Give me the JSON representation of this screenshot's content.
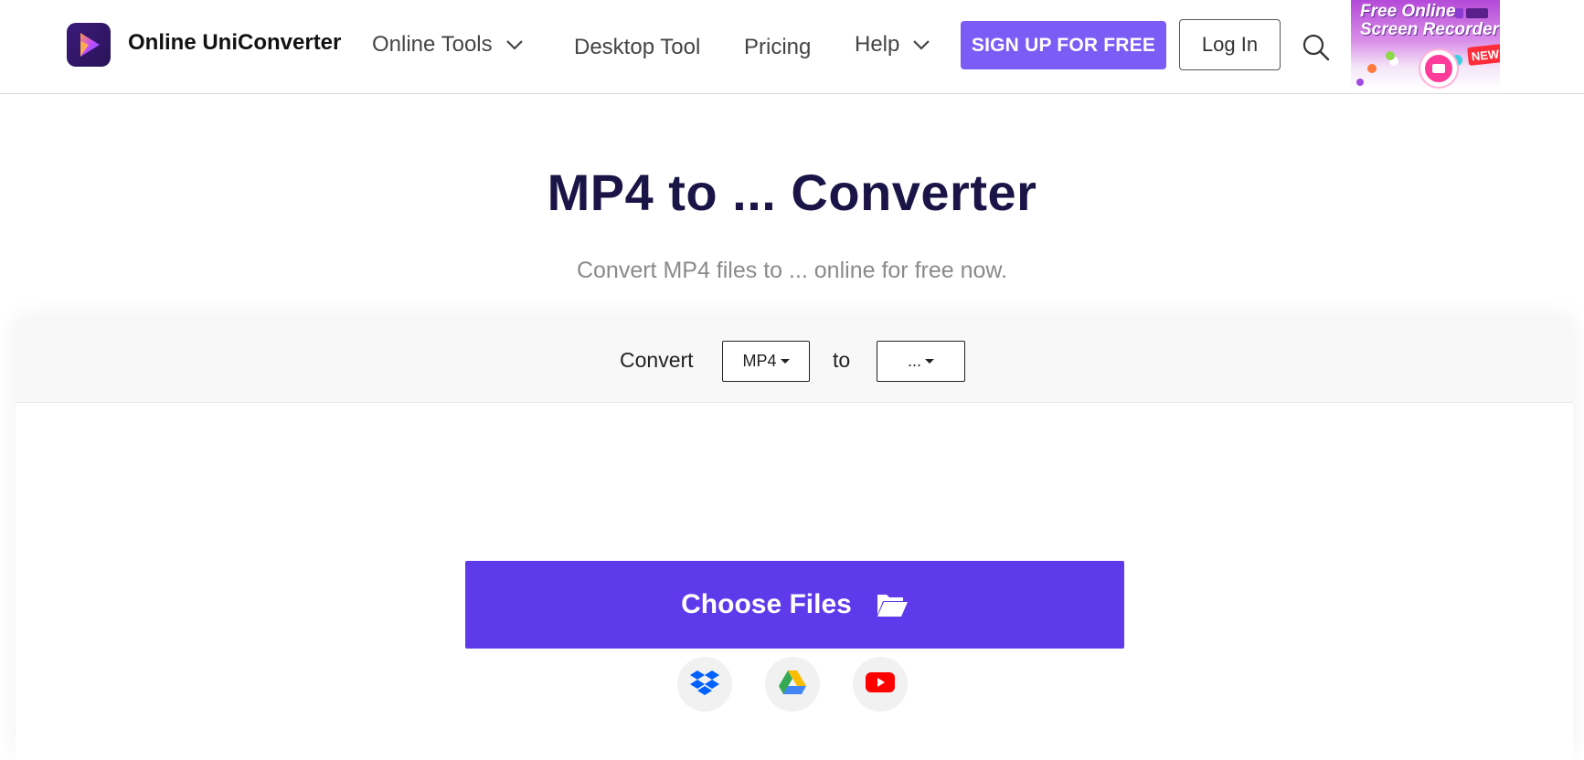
{
  "header": {
    "brand": "Online UniConverter",
    "nav": {
      "online_tools": "Online Tools",
      "desktop_tool": "Desktop Tool",
      "pricing": "Pricing",
      "help": "Help"
    },
    "signup_label": "SIGN UP FOR FREE",
    "login_label": "Log In",
    "ad": {
      "line1": "Free Online",
      "line2": "Screen Recorder",
      "badge": "NEW"
    }
  },
  "hero": {
    "title": "MP4 to ... Converter",
    "subtitle": "Convert MP4 files to ... online for free now."
  },
  "converter": {
    "convert_label": "Convert",
    "from_format": "MP4",
    "to_label": "to",
    "to_format": "...",
    "choose_files_label": "Choose Files",
    "sources": [
      "dropbox-icon",
      "google-drive-icon",
      "youtube-icon"
    ]
  },
  "colors": {
    "accent": "#5e3aea",
    "signup": "#7b5cf5",
    "title": "#1a1546"
  }
}
